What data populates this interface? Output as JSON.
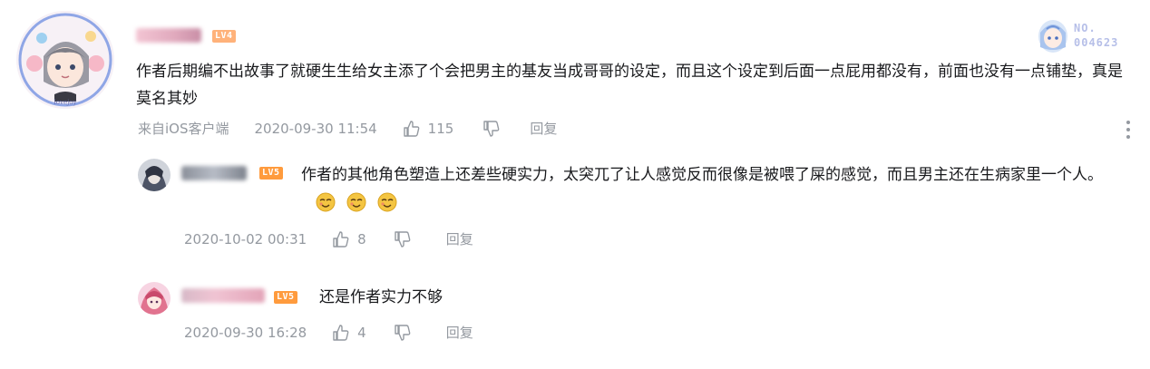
{
  "colors": {
    "text": "#18191c",
    "meta": "#9499a0",
    "level_bg": "#ff9b3d",
    "level_text": "#ffffff",
    "badge_text": "#b6bfe8"
  },
  "main_comment": {
    "level": "LV4",
    "text": "作者后期编不出故事了就硬生生给女主添了个会把男主的基友当成哥哥的设定，而且这个设定到后面一点屁用都没有，前面也没有一点铺垫，真是莫名其妙",
    "source": "来自iOS客户端",
    "time": "2020-09-30 11:54",
    "likes": "115",
    "reply_label": "回复",
    "badge_top": "NO.",
    "badge_number": "004623"
  },
  "replies": [
    {
      "level": "LV5",
      "text": "作者的其他角色塑造上还差些硬实力，太突兀了让人感觉反而很像是被喂了屎的感觉，而且男主还在生病家里一个人。",
      "emoji": [
        "doge-icon",
        "doge-icon",
        "doge-icon"
      ],
      "time": "2020-10-02 00:31",
      "likes": "8",
      "reply_label": "回复"
    },
    {
      "level": "LV5",
      "text": "还是作者实力不够",
      "time": "2020-09-30 16:28",
      "likes": "4",
      "reply_label": "回复"
    }
  ]
}
